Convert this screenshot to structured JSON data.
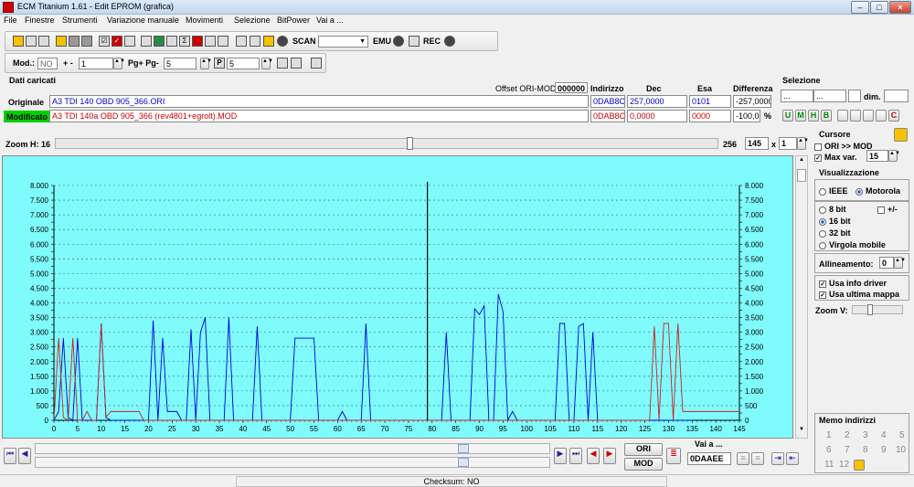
{
  "window": {
    "title": "ECM Titanium 1.61 - Edit EPROM (grafica)"
  },
  "menu": [
    "File",
    "Finestre",
    "Strumenti",
    "Variazione manuale",
    "Movimenti",
    "Selezione",
    "BitPower",
    "Vai a ..."
  ],
  "toolbar1": {
    "scan_label": "SCAN",
    "emu_label": "EMU",
    "rec_label": "REC"
  },
  "toolbar2": {
    "mod_label": "Mod.:",
    "mod_value": "NO",
    "plusminus_label": "+ -",
    "plusminus_value": "1",
    "pg_label": "Pg+ Pg-",
    "pg_value": "5",
    "p_value": "5"
  },
  "dati": {
    "section_label": "Dati caricati",
    "offset_label": "Offset ORI-MOD",
    "offset_value": "000000",
    "col_indirizzo": "Indirizzo",
    "col_dec": "Dec",
    "col_esa": "Esa",
    "col_diff": "Differenza",
    "orig_label": "Originale",
    "orig_file": "A3 TDI 140 OBD 905_366.ORI",
    "orig_addr": "0DAB8C",
    "orig_dec": "257,0000",
    "orig_esa": "0101",
    "orig_diff": "-257,0000",
    "mod_label": "Modificato",
    "mod_file": "A3 TDI 140a OBD 905_366 (rev4801+egrolt).MOD",
    "mod_addr": "0DAB8C",
    "mod_dec": "0,0000",
    "mod_esa": "0000",
    "mod_diff": "-100,0",
    "pct": "%"
  },
  "selezione": {
    "label": "Selezione",
    "f1": "...",
    "f2": "...",
    "dim_label": "dim."
  },
  "zoom": {
    "label": "Zoom H: 16",
    "right_value": "256",
    "field1": "145",
    "x_label": "x",
    "field2": "1"
  },
  "cursore": {
    "label": "Cursore",
    "ori_mod": "ORI >> MOD",
    "maxvar_label": "Max var.",
    "maxvar_value": "15"
  },
  "visualizzazione": {
    "label": "Visualizzazione",
    "ieee": "IEEE",
    "motorola": "Motorola",
    "bit8": "8 bit",
    "plusminus": "+/-",
    "bit16": "16 bit",
    "bit32": "32 bit",
    "float": "Virgola mobile",
    "allineamento_label": "Allineamento:",
    "allineamento_value": "0",
    "usa_info": "Usa info driver",
    "usa_ultima": "Usa ultima mappa",
    "zoomv_label": "Zoom V:"
  },
  "memo": {
    "label": "Memo indirizzi",
    "numbers": [
      "1",
      "2",
      "3",
      "4",
      "5",
      "6",
      "7",
      "8",
      "9",
      "10",
      "11",
      "12"
    ]
  },
  "bottom": {
    "vai_label": "Vai a ...",
    "vai_value": "0DAAEE",
    "ori_btn": "ORI",
    "mod_btn": "MOD"
  },
  "status": {
    "checksum": "Checksum: NO"
  },
  "chart_data": {
    "type": "line",
    "x": [
      0,
      1,
      2,
      3,
      4,
      5,
      6,
      7,
      8,
      9,
      10,
      11,
      12,
      13,
      14,
      15,
      16,
      17,
      18,
      19,
      20,
      21,
      22,
      23,
      24,
      25,
      26,
      27,
      28,
      29,
      30,
      31,
      32,
      33,
      34,
      35,
      36,
      37,
      38,
      39,
      40,
      41,
      42,
      43,
      44,
      45,
      46,
      47,
      48,
      49,
      50,
      51,
      52,
      53,
      54,
      55,
      56,
      57,
      58,
      59,
      60,
      61,
      62,
      63,
      64,
      65,
      66,
      67,
      68,
      69,
      70,
      71,
      72,
      73,
      74,
      75,
      76,
      77,
      78,
      79,
      80,
      81,
      82,
      83,
      84,
      85,
      86,
      87,
      88,
      89,
      90,
      91,
      92,
      93,
      94,
      95,
      96,
      97,
      98,
      99,
      100,
      101,
      102,
      103,
      104,
      105,
      106,
      107,
      108,
      109,
      110,
      111,
      112,
      113,
      114,
      115,
      116,
      117,
      118,
      119,
      120,
      121,
      122,
      123,
      124,
      125,
      126,
      127,
      128,
      129,
      130,
      131,
      132,
      133,
      134,
      135,
      136,
      137,
      138,
      139,
      140,
      141,
      142,
      143,
      144,
      145
    ],
    "series": [
      {
        "color": "#0000dd",
        "values": [
          0,
          300,
          2800,
          100,
          0,
          2800,
          0,
          0,
          0,
          0,
          3300,
          100,
          0,
          0,
          0,
          0,
          0,
          0,
          0,
          0,
          0,
          3400,
          0,
          2800,
          300,
          300,
          300,
          0,
          0,
          3100,
          0,
          3000,
          3500,
          0,
          0,
          0,
          0,
          3500,
          0,
          0,
          0,
          0,
          0,
          3200,
          0,
          0,
          0,
          0,
          0,
          0,
          0,
          2800,
          2800,
          2800,
          2800,
          2800,
          0,
          0,
          0,
          0,
          0,
          300,
          0,
          0,
          0,
          0,
          3300,
          0,
          0,
          0,
          0,
          0,
          0,
          0,
          0,
          0,
          0,
          0,
          0,
          0,
          0,
          0,
          0,
          3000,
          0,
          0,
          0,
          0,
          0,
          3800,
          3600,
          3900,
          0,
          0,
          4300,
          3700,
          0,
          300,
          0,
          0,
          0,
          0,
          0,
          0,
          0,
          0,
          0,
          3300,
          3300,
          0,
          0,
          3200,
          3300,
          0,
          3000,
          0,
          0,
          0,
          0,
          0,
          0,
          0,
          0,
          0,
          0,
          0,
          0,
          0,
          0,
          0,
          0,
          0,
          0,
          0,
          0,
          0
        ]
      },
      {
        "color": "#cc2222",
        "values": [
          0,
          2800,
          100,
          0,
          2800,
          0,
          0,
          300,
          0,
          0,
          3300,
          100,
          300,
          300,
          300,
          300,
          300,
          300,
          300,
          0,
          0,
          0,
          0,
          0,
          0,
          0,
          0,
          0,
          0,
          0,
          0,
          0,
          0,
          0,
          0,
          0,
          0,
          0,
          0,
          0,
          0,
          0,
          0,
          0,
          0,
          0,
          0,
          0,
          0,
          0,
          0,
          0,
          0,
          0,
          0,
          0,
          0,
          0,
          0,
          0,
          0,
          0,
          0,
          0,
          0,
          0,
          0,
          0,
          0,
          0,
          0,
          0,
          0,
          0,
          0,
          0,
          0,
          0,
          0,
          0,
          0,
          0,
          0,
          0,
          0,
          0,
          0,
          0,
          0,
          0,
          0,
          0,
          0,
          0,
          0,
          0,
          0,
          0,
          0,
          0,
          0,
          0,
          0,
          0,
          0,
          0,
          0,
          0,
          0,
          0,
          0,
          0,
          0,
          0,
          0,
          0,
          0,
          0,
          0,
          0,
          0,
          0,
          0,
          0,
          0,
          0,
          0,
          3200,
          0,
          3300,
          3300,
          0,
          3300,
          300,
          300,
          300,
          300,
          300,
          300,
          300,
          300,
          300,
          300,
          300,
          300,
          300
        ]
      }
    ],
    "ylim": [
      0,
      8000
    ],
    "yticks": [
      "0",
      "250",
      "500",
      "750",
      "1.000",
      "1.250",
      "1.500",
      "1.750",
      "2.000",
      "2.250",
      "2.500",
      "2.750",
      "3.000",
      "3.250",
      "3.500",
      "3.750",
      "4.000",
      "4.250",
      "4.500",
      "4.750",
      "5.000",
      "5.250",
      "5.500",
      "5.750",
      "6.000",
      "6.250",
      "6.500",
      "6.750",
      "7.000",
      "7.250",
      "7.500",
      "7.750",
      "8.000"
    ],
    "ytick_values": [
      0,
      250,
      500,
      750,
      1000,
      1250,
      1500,
      1750,
      2000,
      2250,
      2500,
      2750,
      3000,
      3250,
      3500,
      3750,
      4000,
      4250,
      4500,
      4750,
      5000,
      5250,
      5500,
      5750,
      6000,
      6250,
      6500,
      6750,
      7000,
      7250,
      7500,
      7750,
      8000
    ],
    "xticks": [
      "0",
      "5",
      "10",
      "15",
      "20",
      "25",
      "30",
      "35",
      "40",
      "45",
      "50",
      "55",
      "60",
      "65",
      "70",
      "75",
      "80",
      "85",
      "90",
      "95",
      "100",
      "105",
      "110",
      "115",
      "120",
      "125",
      "130",
      "135",
      "140",
      "145"
    ],
    "xtick_values": [
      0,
      5,
      10,
      15,
      20,
      25,
      30,
      35,
      40,
      45,
      50,
      55,
      60,
      65,
      70,
      75,
      80,
      85,
      90,
      95,
      100,
      105,
      110,
      115,
      120,
      125,
      130,
      135,
      140,
      145
    ],
    "cursor_x": 79,
    "grid": true
  }
}
